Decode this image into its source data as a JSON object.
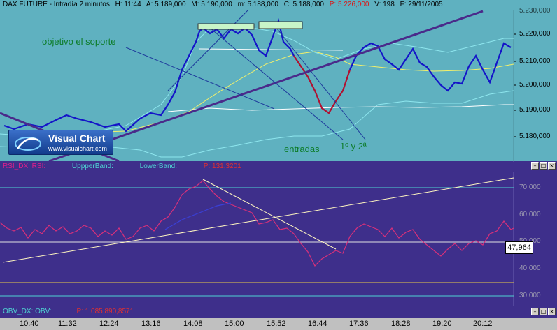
{
  "main_header": {
    "instrument": "DAX FUTURE - Intradía 2 minutos",
    "high": "H: 11:44",
    "ask": "A: 5.189,000",
    "max": "M: 5.190,000",
    "min": "m: 5.188,000",
    "close": "C: 5.188,000",
    "pct": "P: 5.226,000",
    "volume": "V: 198",
    "date": "F: 29/11/2005"
  },
  "price_axis": [
    "5.220,000",
    "5.210,000",
    "5.200,000",
    "5.190,000",
    "5.180,000"
  ],
  "price_axis_top": "5.230,000",
  "annotations": {
    "support": "objetivo el soporte",
    "entries": "entradas",
    "first_second": "1º y 2ª"
  },
  "logo": {
    "title": "Visual Chart",
    "url": "www.visualchart.com"
  },
  "rsi_header": {
    "name": "RSI_DX: RSI:",
    "upper": "UppperBand:",
    "lower": "LowerBand:",
    "p": "P: 131,3201"
  },
  "rsi_axis": [
    "70,000",
    "60,000",
    "50,000",
    "40,000",
    "30,000"
  ],
  "rsi_current": "47,964",
  "obv_header": {
    "name": "OBV_DX: OBV:",
    "p": "P: 1.085.890,8571"
  },
  "time_axis": [
    "10:40",
    "11:32",
    "12:24",
    "13:16",
    "14:08",
    "15:00",
    "15:52",
    "16:44",
    "17:36",
    "18:28",
    "19:20",
    "20:12"
  ],
  "colors": {
    "main_bg": "#5fb1c0",
    "indicator_bg": "#3e2f8b",
    "price_line": "#1414c8",
    "down_bars": "#b01030",
    "trendline": "#4a2a8a",
    "rsi_line": "#d8307a",
    "annotation": "#0e7d2b"
  },
  "icons": [
    "minimize-icon",
    "maximize-icon",
    "close-icon"
  ]
}
